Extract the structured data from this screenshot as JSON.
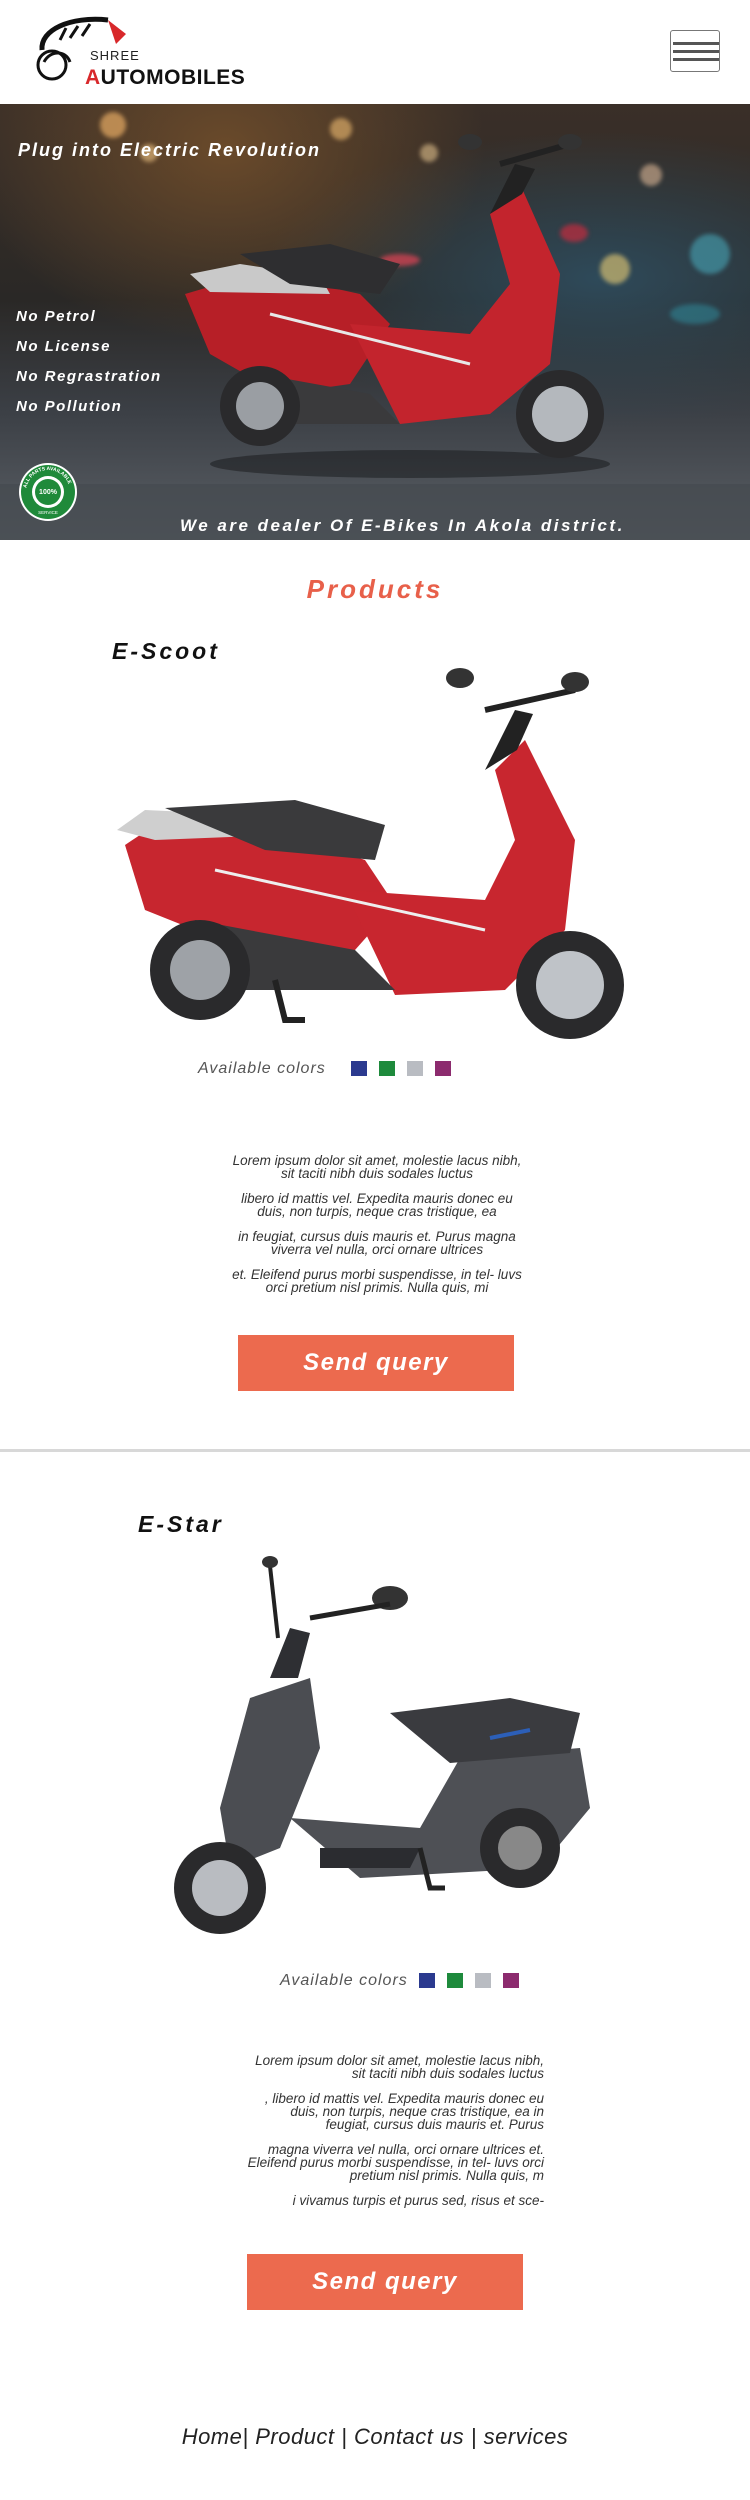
{
  "brand": {
    "logo_top": "SHREE",
    "logo_name_red": "A",
    "logo_name_rest": "UTOMOBILES",
    "logo_name_ob": "OB"
  },
  "hero": {
    "tagline": "Plug into Electric Revolution",
    "points": [
      "No Petrol",
      "No License",
      "No Regrastration",
      "No Pollution"
    ],
    "badge_top": "ALL PARTS AVAILABLE",
    "badge_center": "100%",
    "badge_bottom": "SERVICE",
    "banner": "We are dealer Of E-Bikes In Akola district."
  },
  "products": {
    "title": "Products",
    "items": [
      {
        "name": "E-Scoot",
        "colors_label": "Available  colors",
        "colors": [
          "#2b3a8f",
          "#1e8a3c",
          "#b9bcc2",
          "#8c2b6e"
        ],
        "scooter_color": "#c0242c",
        "description": [
          "Lorem ipsum dolor sit amet, molestie lacus nibh, sit taciti nibh duis sodales luctus",
          "libero id mattis vel. Expedita mauris donec eu duis, non turpis, neque cras tristique, ea",
          "in feugiat, cursus duis mauris et. Purus magna viverra vel nulla, orci ornare ultrices",
          "et. Eleifend purus morbi suspendisse, in tel- luvs orci pretium nisl primis. Nulla quis, mi"
        ],
        "button": "Send query"
      },
      {
        "name": "E-Star",
        "colors_label": "Available  colors",
        "colors": [
          "#2b3a8f",
          "#1e8a3c",
          "#b9bcc2",
          "#8c2b6e"
        ],
        "scooter_color": "#4a4c50",
        "description": [
          "Lorem ipsum dolor sit amet, molestie lacus nibh, sit taciti nibh duis sodales luctus",
          ", libero id mattis vel. Expedita mauris donec eu duis, non turpis, neque cras tristique, ea in feugiat, cursus duis mauris et. Purus",
          "magna viverra vel nulla, orci ornare ultrices et. Eleifend purus morbi suspendisse, in tel- luvs orci pretium nisl primis. Nulla quis, m",
          "i vivamus turpis et purus sed, risus et sce-"
        ],
        "button": "Send query"
      }
    ]
  },
  "footer": {
    "links": [
      "Home",
      "Product ",
      "Contact us ",
      " services"
    ]
  }
}
